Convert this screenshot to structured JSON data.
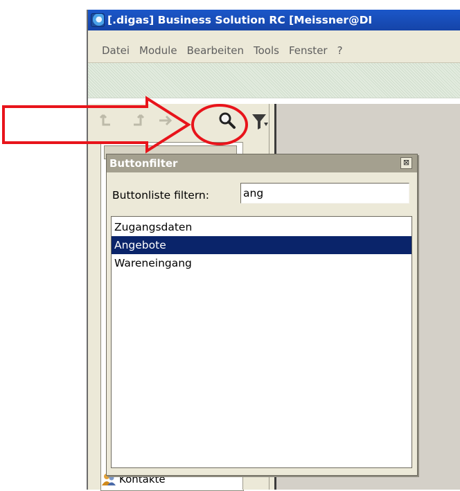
{
  "window": {
    "title": "[.digas] Business Solution RC [Meissner@DI"
  },
  "menu": {
    "items": [
      "Datei",
      "Module",
      "Bearbeiten",
      "Tools",
      "Fenster",
      "?"
    ]
  },
  "toolbar": {
    "icons": [
      "back-arrow-icon",
      "forward-arrow-icon",
      "next-arrow-icon",
      "search-icon",
      "filter-icon"
    ]
  },
  "popup": {
    "title": "Buttonfilter",
    "close_symbol": "⊠",
    "filter_label": "Buttonliste filtern:",
    "filter_value": "ang",
    "items": [
      {
        "label": "Zugangsdaten",
        "selected": false
      },
      {
        "label": "Angebote",
        "selected": true
      },
      {
        "label": "Wareneingang",
        "selected": false
      }
    ]
  },
  "sidebar": {
    "contacts_label": "Kontakte"
  },
  "annotation": {
    "color": "#e8141b"
  }
}
